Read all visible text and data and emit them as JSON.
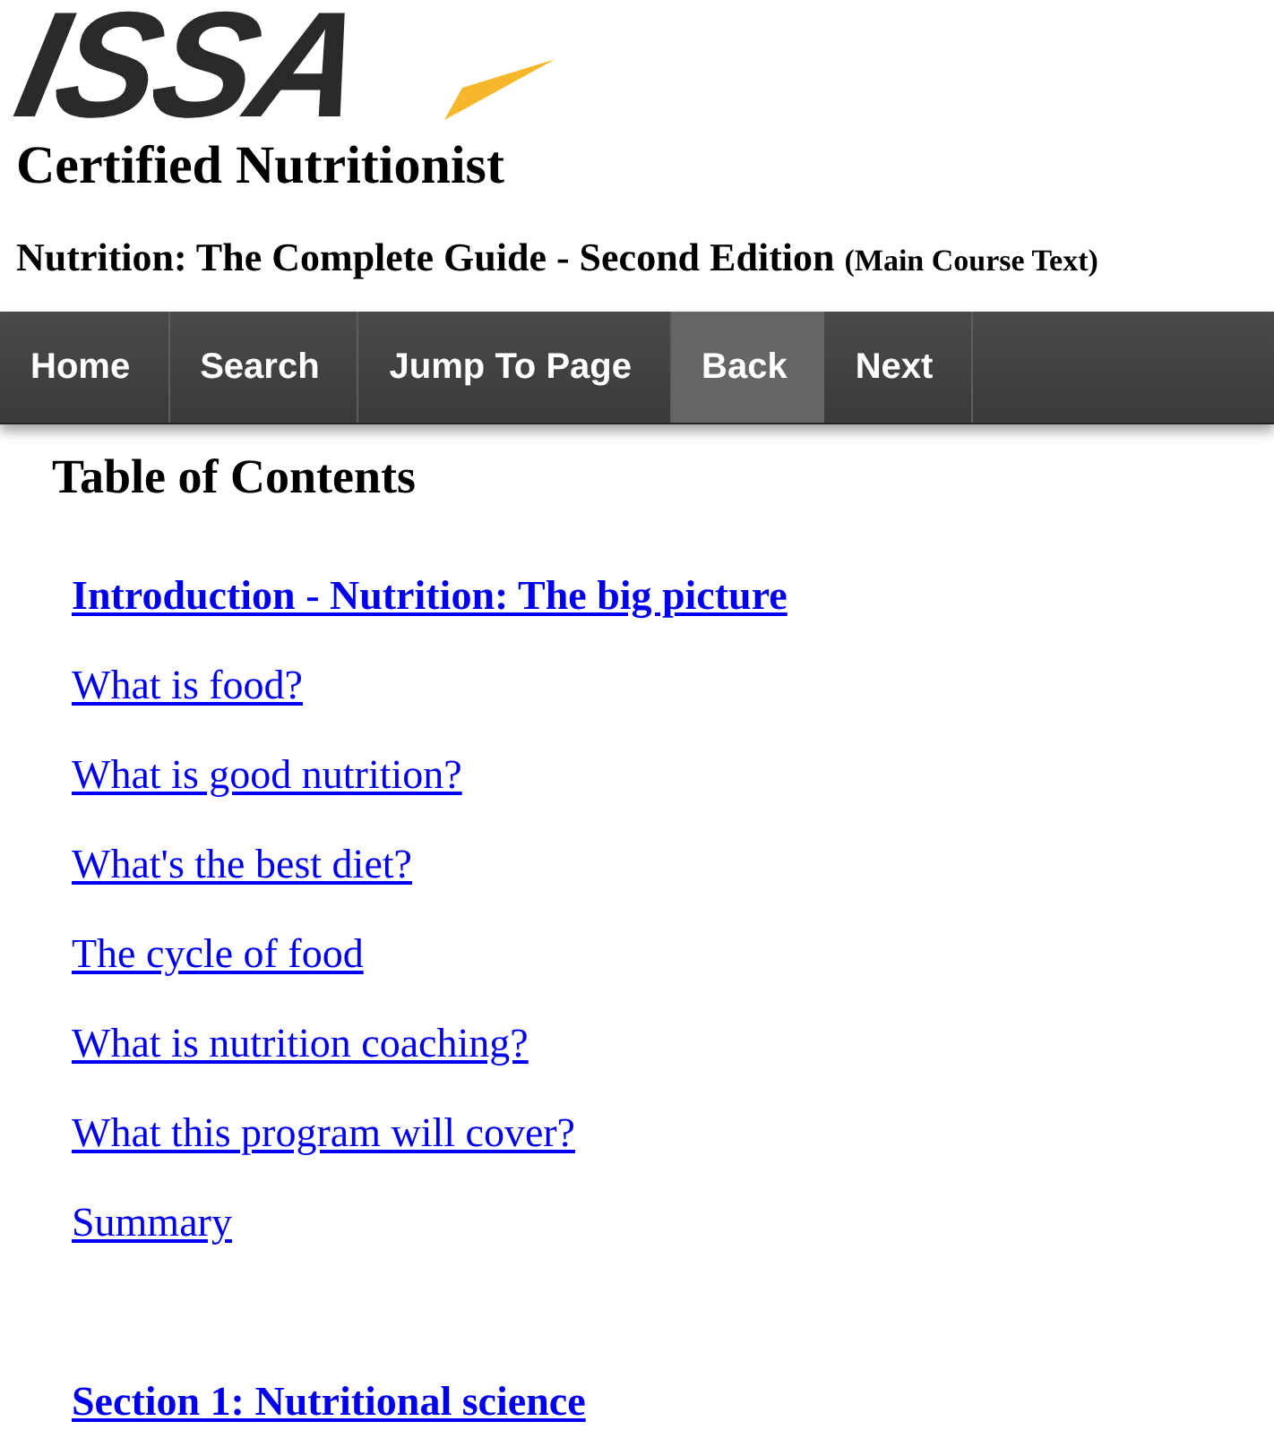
{
  "logo": {
    "text": "ISSA"
  },
  "title": "Certified Nutritionist",
  "subtitle": {
    "text": "Nutrition: The Complete Guide - Second Edition",
    "note": "(Main Course Text)"
  },
  "nav": [
    {
      "label": "Home",
      "selected": false
    },
    {
      "label": "Search",
      "selected": false
    },
    {
      "label": "Jump To Page",
      "selected": false
    },
    {
      "label": "Back",
      "selected": true
    },
    {
      "label": "Next",
      "selected": false
    }
  ],
  "toc": {
    "heading": "Table of Contents",
    "items": [
      {
        "kind": "heading",
        "label": "Introduction - Nutrition: The big picture"
      },
      {
        "kind": "link",
        "label": "What is food?"
      },
      {
        "kind": "link",
        "label": "What is good nutrition?"
      },
      {
        "kind": "link",
        "label": "What's the best diet?"
      },
      {
        "kind": "link",
        "label": "The cycle of food"
      },
      {
        "kind": "link",
        "label": "What is nutrition coaching?"
      },
      {
        "kind": "link",
        "label": "What this program will cover?"
      },
      {
        "kind": "link",
        "label": "Summary"
      },
      {
        "kind": "heading",
        "label": "Section 1: Nutritional science"
      }
    ]
  }
}
